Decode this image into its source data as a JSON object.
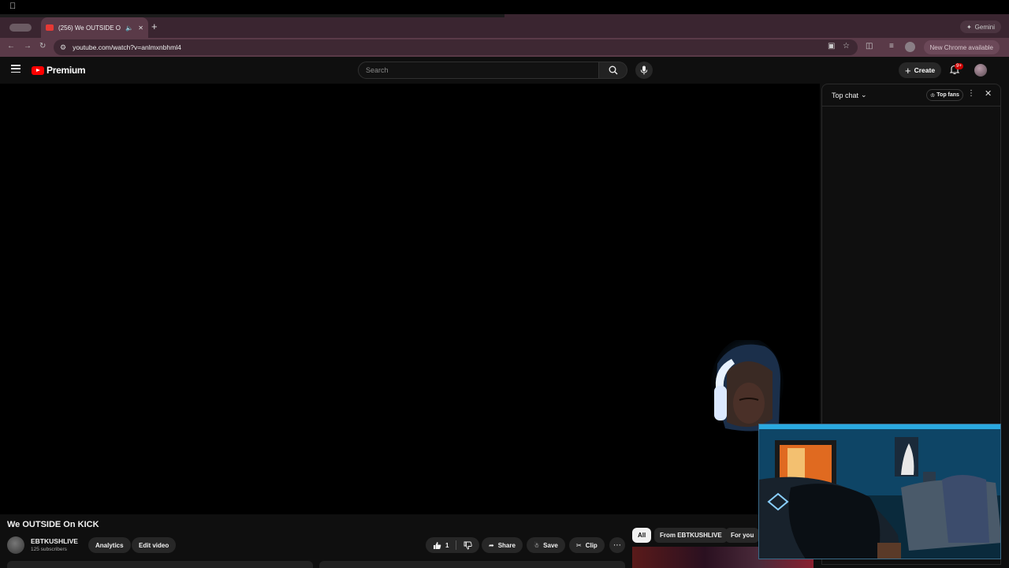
{
  "browser": {
    "tab_title": "(256) We OUTSIDE On KICK",
    "url": "youtube.com/watch?v=anlmxnbhml4",
    "gemini_label": "Gemini",
    "update_label": "New Chrome available"
  },
  "masthead": {
    "brand": "Premium",
    "search_placeholder": "Search",
    "create_label": "Create",
    "notification_badge": "9+"
  },
  "chat": {
    "mode_label": "Top chat",
    "top_fans_label": "Top fans"
  },
  "video": {
    "title": "We OUTSIDE On KICK",
    "channel_name": "EBTKUSHLIVE",
    "subscribers": "125 subscribers",
    "analytics_label": "Analytics",
    "edit_label": "Edit video",
    "like_count": "1",
    "share_label": "Share",
    "save_label": "Save",
    "clip_label": "Clip"
  },
  "related_chips": [
    "All",
    "From EBTKUSHLIVE",
    "For you"
  ],
  "colors": {
    "brand_red": "#ff0000",
    "chrome_frame": "#5a3a48",
    "background": "#0f0f0f"
  }
}
